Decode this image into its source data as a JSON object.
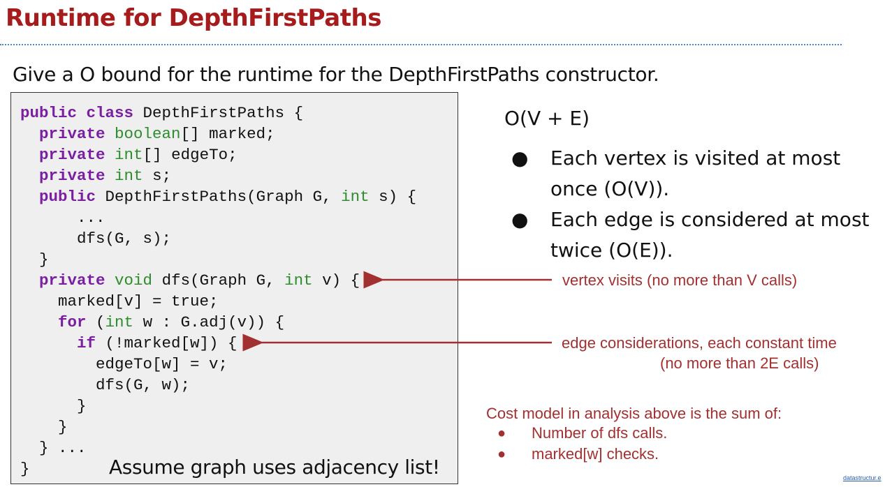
{
  "slide": {
    "title": "Runtime for DepthFirstPaths",
    "question": "Give a O bound for the runtime for the DepthFirstPaths constructor.",
    "assumption": "Assume graph uses adjacency list!",
    "answer": "O(V + E)",
    "bullets": [
      "Each vertex is visited at most once (O(V)).",
      "Each edge is considered at most twice (O(E))."
    ],
    "annotations": {
      "vertex": "vertex visits (no more than V calls)",
      "edge_line1": "edge considerations, each constant time",
      "edge_line2": "(no more than 2E calls)"
    },
    "cost_model": {
      "heading": "Cost model in analysis above is the sum of:",
      "items": [
        "Number of dfs calls.",
        "marked[w] checks."
      ]
    },
    "footer": "datastructur.e",
    "colors": {
      "title": "#a61c1c",
      "annotation": "#a33030",
      "keyword": "#7a1fa2",
      "type": "#2e8b2e",
      "code_bg": "#efefef",
      "divider": "#4a86c8"
    }
  },
  "code_lines": [
    [
      {
        "k": "kw",
        "t": "public"
      },
      {
        "t": " "
      },
      {
        "k": "kw",
        "t": "class"
      },
      {
        "t": " DepthFirstPaths {"
      }
    ],
    [
      {
        "t": "  "
      },
      {
        "k": "kw",
        "t": "private"
      },
      {
        "t": " "
      },
      {
        "k": "ty",
        "t": "boolean"
      },
      {
        "t": "[] marked;"
      }
    ],
    [
      {
        "t": "  "
      },
      {
        "k": "kw",
        "t": "private"
      },
      {
        "t": " "
      },
      {
        "k": "ty",
        "t": "int"
      },
      {
        "t": "[] edgeTo;"
      }
    ],
    [
      {
        "t": "  "
      },
      {
        "k": "kw",
        "t": "private"
      },
      {
        "t": " "
      },
      {
        "k": "ty",
        "t": "int"
      },
      {
        "t": " s;"
      }
    ],
    [
      {
        "t": "  "
      },
      {
        "k": "kw",
        "t": "public"
      },
      {
        "t": " DepthFirstPaths(Graph G, "
      },
      {
        "k": "ty",
        "t": "int"
      },
      {
        "t": " s) {"
      }
    ],
    [
      {
        "t": "      ..."
      }
    ],
    [
      {
        "t": "      dfs(G, s);"
      }
    ],
    [
      {
        "t": "  }"
      }
    ],
    [
      {
        "t": "  "
      },
      {
        "k": "kw",
        "t": "private"
      },
      {
        "t": " "
      },
      {
        "k": "ty",
        "t": "void"
      },
      {
        "t": " dfs(Graph G, "
      },
      {
        "k": "ty",
        "t": "int"
      },
      {
        "t": " v) {"
      }
    ],
    [
      {
        "t": "    marked[v] = true;"
      }
    ],
    [
      {
        "t": "    "
      },
      {
        "k": "kw",
        "t": "for"
      },
      {
        "t": " ("
      },
      {
        "k": "ty",
        "t": "int"
      },
      {
        "t": " w : G.adj(v)) {"
      }
    ],
    [
      {
        "t": "      "
      },
      {
        "k": "kw",
        "t": "if"
      },
      {
        "t": " (!marked[w]) {"
      }
    ],
    [
      {
        "t": "        edgeTo[w] = v;"
      }
    ],
    [
      {
        "t": "        dfs(G, w);"
      }
    ],
    [
      {
        "t": "      }"
      }
    ],
    [
      {
        "t": "    }"
      }
    ],
    [
      {
        "t": "  } ..."
      }
    ],
    [
      {
        "t": "}"
      }
    ]
  ]
}
